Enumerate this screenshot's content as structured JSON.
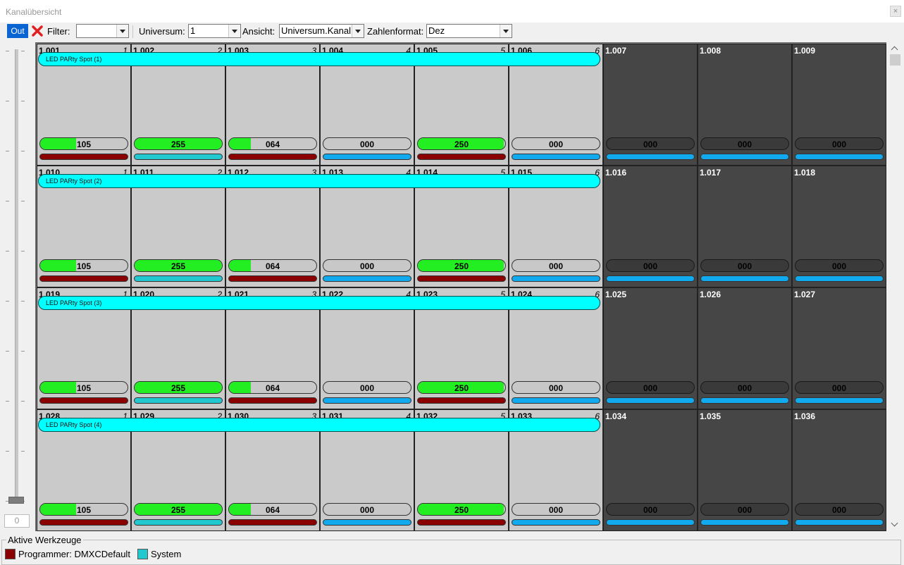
{
  "window": {
    "title": "Kanalübersicht",
    "close_label": "×"
  },
  "toolbar": {
    "out_label": "Out",
    "filter_label": "Filter:",
    "filter_value": "",
    "universe_label": "Universum:",
    "universe_value": "1",
    "view_label": "Ansicht:",
    "view_value": "Universum.Kanal",
    "format_label": "Zahlenformat:",
    "format_value": "Dez"
  },
  "slider": {
    "value": "0",
    "level": 0
  },
  "colors": {
    "programmer": "#8b0000",
    "system": "#21c8d0",
    "value_fill": "#22ee22",
    "device_bar": "#00ffff",
    "blue_tool": "#11aaee"
  },
  "grid": {
    "rows": [
      {
        "device": "LED PARty Spot (1)",
        "cells": [
          {
            "id": "1.001",
            "num": "1",
            "value": "105",
            "level": 105,
            "tool": "programmer",
            "active": true
          },
          {
            "id": "1.002",
            "num": "2",
            "value": "255",
            "level": 255,
            "tool": "system",
            "active": true
          },
          {
            "id": "1.003",
            "num": "3",
            "value": "064",
            "level": 64,
            "tool": "programmer",
            "active": true
          },
          {
            "id": "1.004",
            "num": "4",
            "value": "000",
            "level": 0,
            "tool": "blue",
            "active": true
          },
          {
            "id": "1.005",
            "num": "5",
            "value": "250",
            "level": 250,
            "tool": "programmer",
            "active": true
          },
          {
            "id": "1.006",
            "num": "6",
            "value": "000",
            "level": 0,
            "tool": "blue",
            "active": true
          },
          {
            "id": "1.007",
            "num": "",
            "value": "000",
            "level": 0,
            "tool": "blue",
            "active": false
          },
          {
            "id": "1.008",
            "num": "",
            "value": "000",
            "level": 0,
            "tool": "blue",
            "active": false
          },
          {
            "id": "1.009",
            "num": "",
            "value": "000",
            "level": 0,
            "tool": "blue",
            "active": false
          }
        ]
      },
      {
        "device": "LED PARty Spot (2)",
        "cells": [
          {
            "id": "1.010",
            "num": "1",
            "value": "105",
            "level": 105,
            "tool": "programmer",
            "active": true
          },
          {
            "id": "1.011",
            "num": "2",
            "value": "255",
            "level": 255,
            "tool": "system",
            "active": true
          },
          {
            "id": "1.012",
            "num": "3",
            "value": "064",
            "level": 64,
            "tool": "programmer",
            "active": true
          },
          {
            "id": "1.013",
            "num": "4",
            "value": "000",
            "level": 0,
            "tool": "blue",
            "active": true
          },
          {
            "id": "1.014",
            "num": "5",
            "value": "250",
            "level": 250,
            "tool": "programmer",
            "active": true
          },
          {
            "id": "1.015",
            "num": "6",
            "value": "000",
            "level": 0,
            "tool": "blue",
            "active": true
          },
          {
            "id": "1.016",
            "num": "",
            "value": "000",
            "level": 0,
            "tool": "blue",
            "active": false
          },
          {
            "id": "1.017",
            "num": "",
            "value": "000",
            "level": 0,
            "tool": "blue",
            "active": false
          },
          {
            "id": "1.018",
            "num": "",
            "value": "000",
            "level": 0,
            "tool": "blue",
            "active": false
          }
        ]
      },
      {
        "device": "LED PARty Spot (3)",
        "cells": [
          {
            "id": "1.019",
            "num": "1",
            "value": "105",
            "level": 105,
            "tool": "programmer",
            "active": true
          },
          {
            "id": "1.020",
            "num": "2",
            "value": "255",
            "level": 255,
            "tool": "system",
            "active": true
          },
          {
            "id": "1.021",
            "num": "3",
            "value": "064",
            "level": 64,
            "tool": "programmer",
            "active": true
          },
          {
            "id": "1.022",
            "num": "4",
            "value": "000",
            "level": 0,
            "tool": "blue",
            "active": true
          },
          {
            "id": "1.023",
            "num": "5",
            "value": "250",
            "level": 250,
            "tool": "programmer",
            "active": true
          },
          {
            "id": "1.024",
            "num": "6",
            "value": "000",
            "level": 0,
            "tool": "blue",
            "active": true
          },
          {
            "id": "1.025",
            "num": "",
            "value": "000",
            "level": 0,
            "tool": "blue",
            "active": false
          },
          {
            "id": "1.026",
            "num": "",
            "value": "000",
            "level": 0,
            "tool": "blue",
            "active": false
          },
          {
            "id": "1.027",
            "num": "",
            "value": "000",
            "level": 0,
            "tool": "blue",
            "active": false
          }
        ]
      },
      {
        "device": "LED PARty Spot (4)",
        "cells": [
          {
            "id": "1.028",
            "num": "1",
            "value": "105",
            "level": 105,
            "tool": "programmer",
            "active": true
          },
          {
            "id": "1.029",
            "num": "2",
            "value": "255",
            "level": 255,
            "tool": "system",
            "active": true
          },
          {
            "id": "1.030",
            "num": "3",
            "value": "064",
            "level": 64,
            "tool": "programmer",
            "active": true
          },
          {
            "id": "1.031",
            "num": "4",
            "value": "000",
            "level": 0,
            "tool": "blue",
            "active": true
          },
          {
            "id": "1.032",
            "num": "5",
            "value": "250",
            "level": 250,
            "tool": "programmer",
            "active": true
          },
          {
            "id": "1.033",
            "num": "6",
            "value": "000",
            "level": 0,
            "tool": "blue",
            "active": true
          },
          {
            "id": "1.034",
            "num": "",
            "value": "000",
            "level": 0,
            "tool": "blue",
            "active": false
          },
          {
            "id": "1.035",
            "num": "",
            "value": "000",
            "level": 0,
            "tool": "blue",
            "active": false
          },
          {
            "id": "1.036",
            "num": "",
            "value": "000",
            "level": 0,
            "tool": "blue",
            "active": false
          }
        ]
      }
    ]
  },
  "active_tools": {
    "title": "Aktive Werkzeuge",
    "items": [
      {
        "label": "Programmer: DMXCDefault",
        "color": "#8b0000"
      },
      {
        "label": "System",
        "color": "#21c8d0"
      }
    ]
  }
}
